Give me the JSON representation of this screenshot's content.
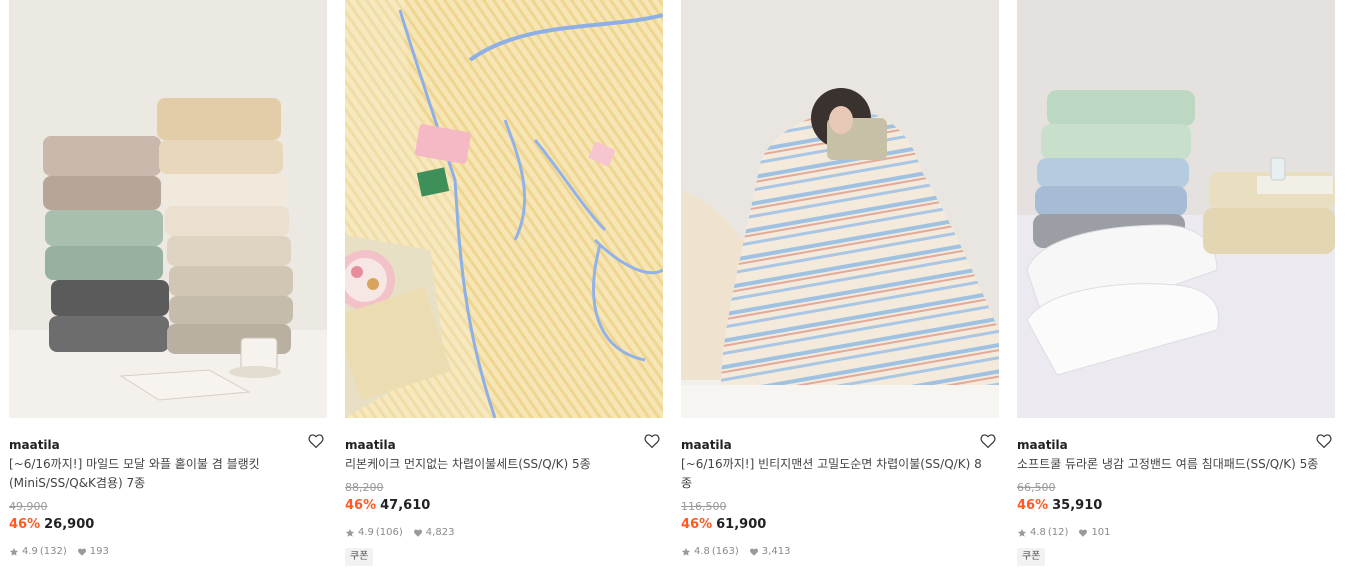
{
  "products": [
    {
      "brand": "maatila",
      "title": "[~6/16까지!] 마일드 모달 와플 홑이불 겸 블랭킷 (MiniS/SS/Q&K겸용) 7종",
      "original_price": "49,900",
      "discount": "46%",
      "price": "26,900",
      "rating": "4.9",
      "reviews": "(132)",
      "likes": "193",
      "coupon": ""
    },
    {
      "brand": "maatila",
      "title": "리본케이크 먼지없는 차렵이불세트(SS/Q/K) 5종",
      "original_price": "88,200",
      "discount": "46%",
      "price": "47,610",
      "rating": "4.9",
      "reviews": "(106)",
      "likes": "4,823",
      "coupon": "쿠폰"
    },
    {
      "brand": "maatila",
      "title": "[~6/16까지!] 빈티지맨션 고밀도순면 차렵이불(SS/Q/K) 8종",
      "original_price": "116,500",
      "discount": "46%",
      "price": "61,900",
      "rating": "4.8",
      "reviews": "(163)",
      "likes": "3,413",
      "coupon": ""
    },
    {
      "brand": "maatila",
      "title": "소프트쿨 듀라론 냉감 고정밴드 여름 침대패드(SS/Q/K) 5종",
      "original_price": "66,500",
      "discount": "46%",
      "price": "35,910",
      "rating": "4.8",
      "reviews": "(12)",
      "likes": "101",
      "coupon": "쿠폰"
    }
  ],
  "icons": {
    "wishlist": "heart-outline-icon",
    "rating": "star-icon",
    "likes": "heart-filled-icon"
  },
  "colors": {
    "discount": "#ff5a1f",
    "original_price": "#9a9a9a",
    "meta": "#8a8a8a"
  }
}
